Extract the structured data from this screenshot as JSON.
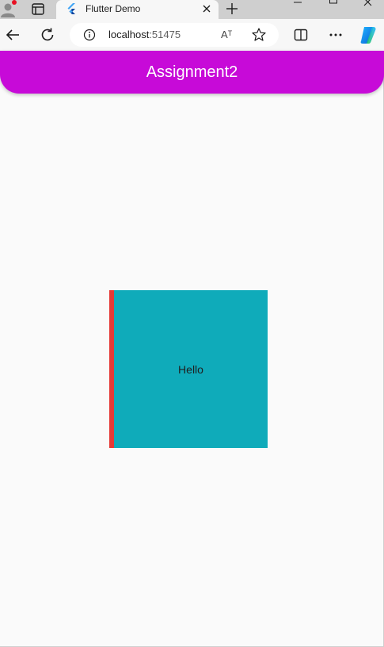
{
  "browser": {
    "tab": {
      "title": "Flutter Demo"
    },
    "address_bar": {
      "host": "localhost",
      "port": ":51475"
    },
    "read_aloud_label": "Aᵀ",
    "colors": {
      "tab_strip": "#cfcfcf",
      "toolbar": "#f7f7f7",
      "notification_dot": "#e81123"
    },
    "icons": [
      "profile-icon",
      "tab-actions-icon",
      "flutter-logo-icon",
      "close-icon",
      "plus-icon",
      "minimize-icon",
      "maximize-icon",
      "window-close-icon",
      "back-arrow-icon",
      "refresh-icon",
      "info-icon",
      "read-aloud-icon",
      "star-icon",
      "split-screen-icon",
      "more-icon",
      "copilot-icon"
    ]
  },
  "app": {
    "appbar": {
      "title": "Assignment2",
      "color": "#c70ad8"
    },
    "box": {
      "label": "Hello",
      "fill_color": "#0fabba",
      "border_color": "#e53935"
    },
    "background": "#fafafa"
  }
}
